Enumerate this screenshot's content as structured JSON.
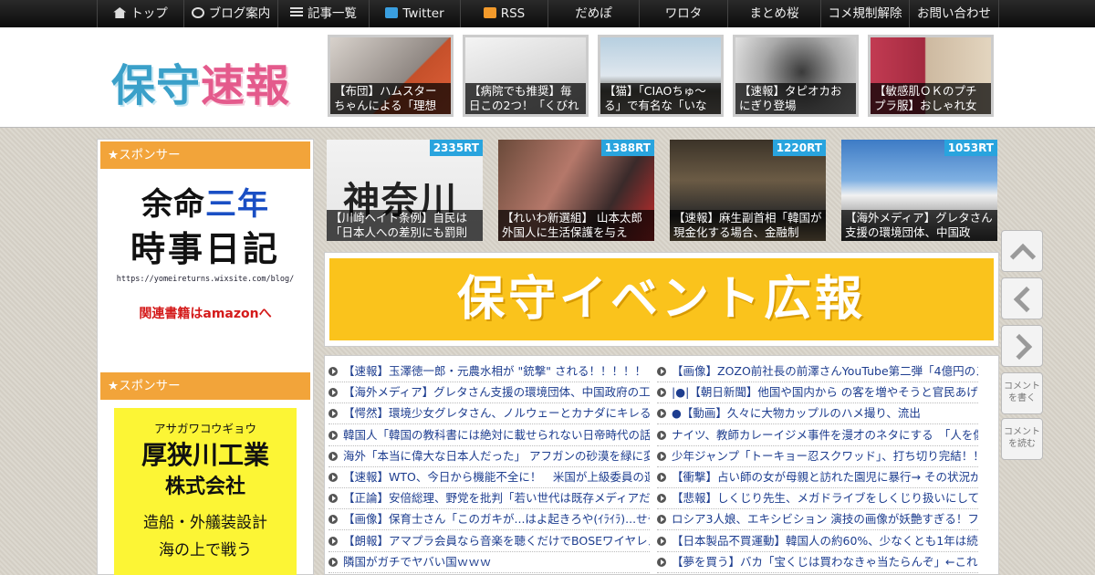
{
  "nav": {
    "items": [
      {
        "label": "トップ",
        "icon": "home-icon"
      },
      {
        "label": "ブログ案内",
        "icon": "info-icon"
      },
      {
        "label": "記事一覧",
        "icon": "list-icon"
      },
      {
        "label": "Twitter",
        "icon": "twitter-icon"
      },
      {
        "label": "RSS",
        "icon": "rss-icon"
      },
      {
        "label": "だめぽ"
      },
      {
        "label": "ワロタ"
      },
      {
        "label": "まとめ桜"
      },
      {
        "label": "コメ規制解除"
      },
      {
        "label": "お問い合わせ"
      }
    ]
  },
  "header": {
    "logo_part1": "保守",
    "logo_part2": "速報",
    "thumbs": [
      {
        "caption": "【布団】ハムスターちゃんによる「理想"
      },
      {
        "caption": "【病院でも推奨】毎日この2つ！「くびれ"
      },
      {
        "caption": "【猫】「CIAOちゅ〜る」で有名な「いな"
      },
      {
        "caption": "【速報】タピオカおにぎり登場"
      },
      {
        "caption": "【敏感肌ＯＫのプチプラ服】おしゃれ女"
      }
    ]
  },
  "sidebar": {
    "sponsor_label": "★スポンサー",
    "ad1": {
      "line1a": "余命",
      "line1b": "三年",
      "line2": "時事日記",
      "url": "https://yomeireturns.wixsite.com/blog/",
      "amazon": "関連書籍はamazonへ"
    },
    "ad2": {
      "kana": "アサガワコウギョウ",
      "name": "厚狭川工業",
      "corp": "株式会社",
      "desc": "造船・外艤装設計",
      "extra": "海の上で戦う"
    }
  },
  "rt_items": [
    {
      "badge": "2335RT",
      "caption": "【川崎ヘイト条例】自民は「日本人への差別にも罰則"
    },
    {
      "badge": "1388RT",
      "caption": "【れいわ新選組】 山本太郎 外国人に生活保護を与え"
    },
    {
      "badge": "1220RT",
      "caption": "【速報】麻生副首相「韓国が現金化する場合、金融制"
    },
    {
      "badge": "1053RT",
      "caption": "【海外メディア】グレタさん支援の環境団体、中国政"
    }
  ],
  "banner": {
    "text": "保守イベント広報"
  },
  "headlines_left": [
    "【速報】玉澤徳一郎・元農水相が \"銃撃\" される！！！！！",
    "【海外メディア】グレタさん支援の環境団体、中国政府の工作",
    "【愕然】環境少女グレタさん、ノルウェーとカナダにキレるｗ",
    "韓国人「韓国の教科書には絶対に載せられない日帝時代の話」",
    "海外「本当に偉大な日本人だった」 アフガンの砂漠を緑に変え",
    "【速報】WTO、今日から機能不全に！　米国が上級委員の選任",
    "【正論】安倍総理、野党を批判「若い世代は既存メディアだけ",
    "【画像】保育士さん「このガキが...はよ起きろや(ｲﾗｲﾗ)...せや！",
    "【朗報】アマプラ会員なら音楽を聴くだけでBOSEワイヤレス",
    "隣国がガチでヤバい国ｗｗｗ"
  ],
  "headlines_right": [
    "【画像】ZOZO前社長の前澤さんYouTube第二弾「4億円のスー",
    "|●|【朝日新聞】他国や国内から の客を増やそうと官民あげて対",
    "●【動画】久々に大物カップルのハメ撮り、流出",
    "ナイツ、教師カレーイジメ事件を漫才のネタにする　「人を傷",
    "少年ジャンプ「トーキョー忍スクワッド」、打ち切り完結！！",
    "【衝撃】占い師の女が母親と訪れた園児に暴行→ その状況がヤ",
    "【悲報】しくじり先生、メガドライブをしくじり扱いにしてし",
    "ロシア3人娘、エキシビション 演技の画像が妖艶すぎる！フィ",
    "【日本製品不買運動】韓国人の約60%、少なくとも1年は続ける",
    "【夢を買う】バカ「宝くじは買わなきゃ当たらんぞ」←これ"
  ],
  "side_buttons": {
    "write_comment": "コメントを書く",
    "read_comment": "コメントを読む"
  },
  "colors": {
    "accent_orange": "#f2a43a",
    "rt_badge": "#29a4de",
    "banner_yellow": "#fac31c",
    "link_blue": "#1d3d8f"
  }
}
